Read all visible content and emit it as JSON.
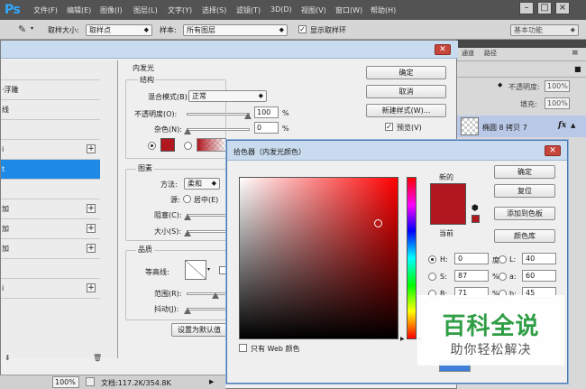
{
  "app": {
    "logo": "Ps",
    "menu": [
      "文件(F)",
      "编辑(E)",
      "图像(I)",
      "图层(L)",
      "文字(Y)",
      "选择(S)",
      "滤镜(T)",
      "3D(D)",
      "视图(V)",
      "窗口(W)",
      "帮助(H)"
    ],
    "window_buttons": [
      "–",
      "□",
      "×"
    ]
  },
  "options_bar": {
    "sample_size_label": "取样大小:",
    "sample_size_value": "取样点",
    "sample_label": "样本:",
    "sample_value": "所有图层",
    "show_ring_label": "显示取样环",
    "show_ring_checked": true,
    "workspace": "基本功能"
  },
  "layer_style_list": {
    "items": [
      {
        "label": ""
      },
      {
        "label": "·浮雕"
      },
      {
        "label": "线"
      },
      {
        "label": ""
      },
      {
        "label": "i"
      },
      {
        "label": "t",
        "selected": true
      },
      {
        "label": ""
      },
      {
        "label": "加"
      },
      {
        "label": "加"
      },
      {
        "label": "加"
      },
      {
        "label": ""
      },
      {
        "label": "i"
      }
    ],
    "plus_rows": [
      4,
      7,
      8,
      9,
      11
    ]
  },
  "layer_style": {
    "section_title": "内发光",
    "structure": {
      "title": "结构",
      "blend_mode_label": "混合模式(B):",
      "blend_mode_value": "正常",
      "opacity_label": "不透明度(O):",
      "opacity_value": "100",
      "noise_label": "杂色(N):",
      "noise_value": "0",
      "percent": "%"
    },
    "elements": {
      "title": "图素",
      "method_label": "方法:",
      "method_value": "柔和",
      "source_label": "源:",
      "source_center": "居中(E)",
      "choke_label": "阻塞(C):",
      "size_label": "大小(S):"
    },
    "quality": {
      "title": "品质",
      "contour_label": "等高线:",
      "range_label": "范围(R):",
      "jitter_label": "抖动(J):"
    },
    "default_button": "设置为默认值",
    "buttons": {
      "ok": "确定",
      "cancel": "取消",
      "new_style": "新建样式(W)...",
      "preview": "预览(V)",
      "preview_checked": true
    },
    "glow_color": "#b0171f"
  },
  "layers_panel": {
    "tabs": [
      "通道",
      "路径"
    ],
    "opacity_label": "不透明度:",
    "opacity_value": "100%",
    "fill_label": "填充:",
    "fill_value": "100%",
    "layer_name": "椭圆 8 拷贝 7",
    "fx": "fx"
  },
  "color_picker": {
    "title": "拾色器（内发光颜色）",
    "new_label": "新的",
    "current_label": "当前",
    "new_color": "#b0171f",
    "current_color": "#b0171f",
    "buttons": {
      "ok": "确定",
      "reset": "复位",
      "add_swatch": "添加到色板",
      "libraries": "颜色库"
    },
    "hsb": [
      {
        "label": "H:",
        "value": "0",
        "unit": "度",
        "on": true
      },
      {
        "label": "S:",
        "value": "87",
        "unit": "%",
        "on": false
      },
      {
        "label": "B:",
        "value": "71",
        "unit": "%",
        "on": false
      }
    ],
    "lab": [
      {
        "label": "L:",
        "value": "40"
      },
      {
        "label": "a:",
        "value": "60"
      },
      {
        "label": "b:",
        "value": "45"
      }
    ],
    "web_only_label": "只有 Web 颜色",
    "web_only_checked": false
  },
  "status_bar": {
    "zoom": "100%",
    "doc_info": "文档:117.2K/354.8K"
  },
  "watermark": {
    "title": "百科全说",
    "subtitle": "助你轻松解决"
  }
}
